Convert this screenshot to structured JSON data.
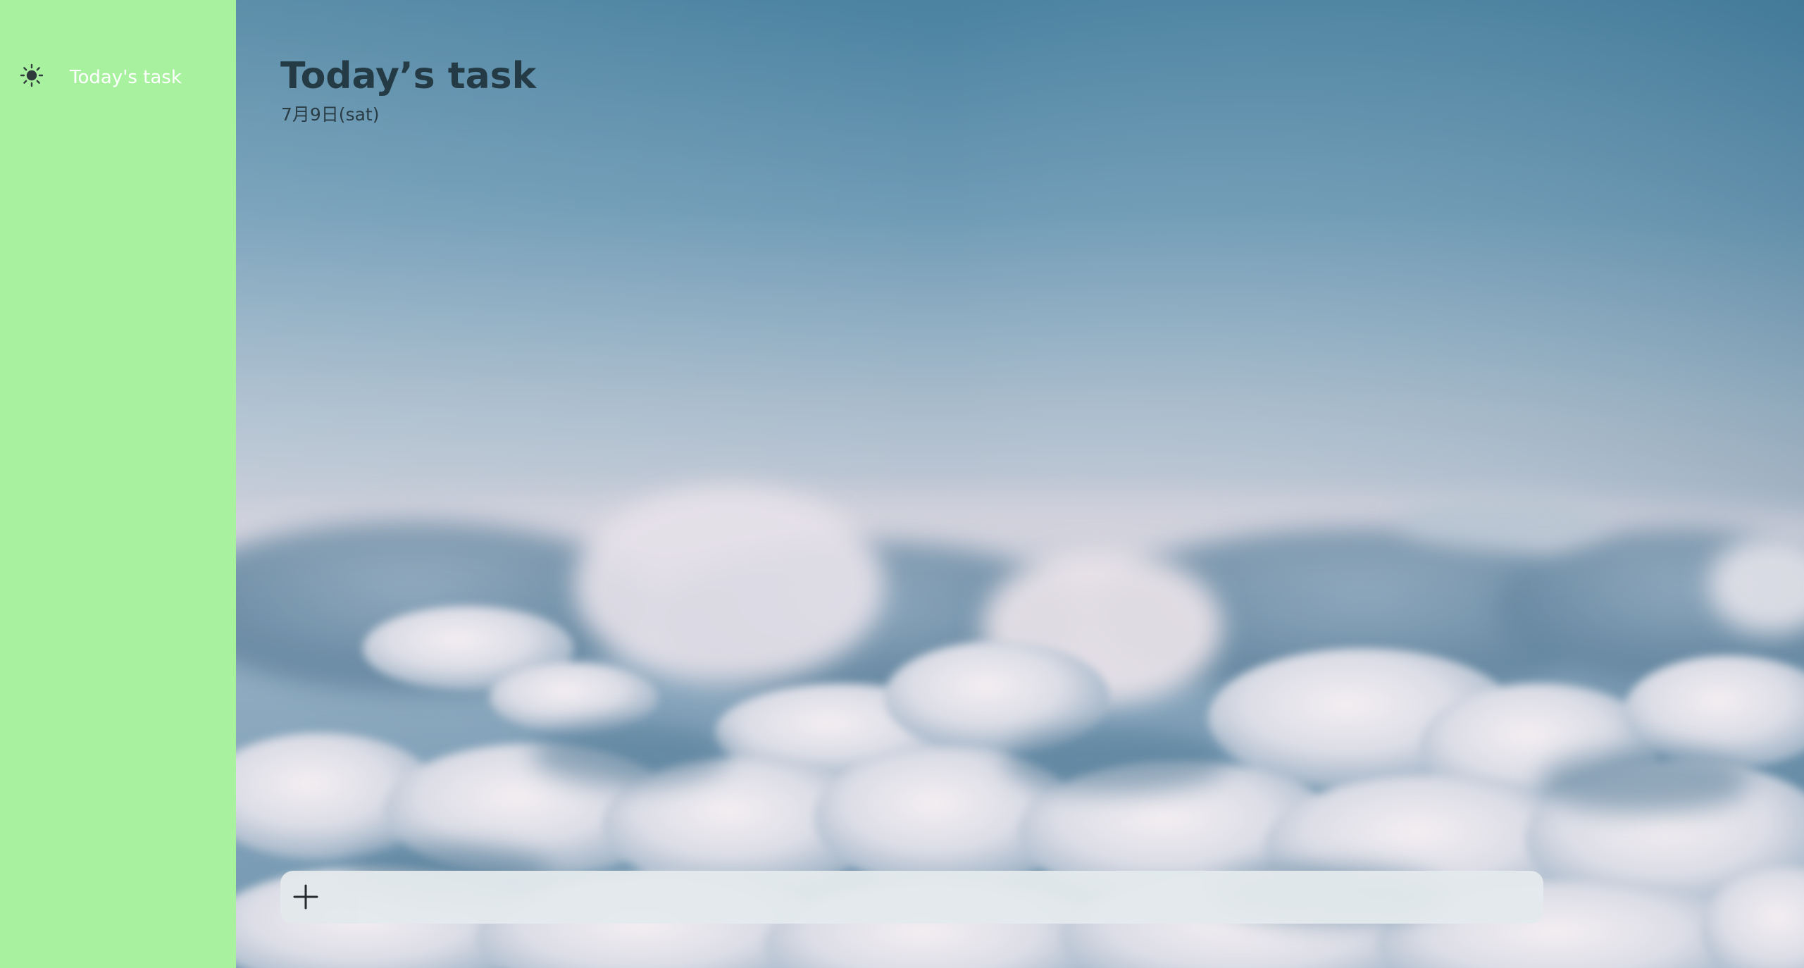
{
  "colors": {
    "sidebar_bg": "#a8f29f",
    "sidebar_text": "#ffffff",
    "sidebar_icon": "#2f3a3a",
    "title_text": "#243b45",
    "date_text": "#2a3c44",
    "add_bar_bg": "#e3e9ec",
    "sky_top": "#4a82a0",
    "sky_mid": "#a9bccc",
    "cloud_shadow": "#5a7e98"
  },
  "sidebar": {
    "items": [
      {
        "label": "Today's task",
        "icon": "sun-icon"
      }
    ]
  },
  "main": {
    "title": "Today’s task",
    "date": "7月9日(sat)",
    "add_task": {
      "icon": "plus-icon",
      "value": "",
      "placeholder": ""
    }
  }
}
